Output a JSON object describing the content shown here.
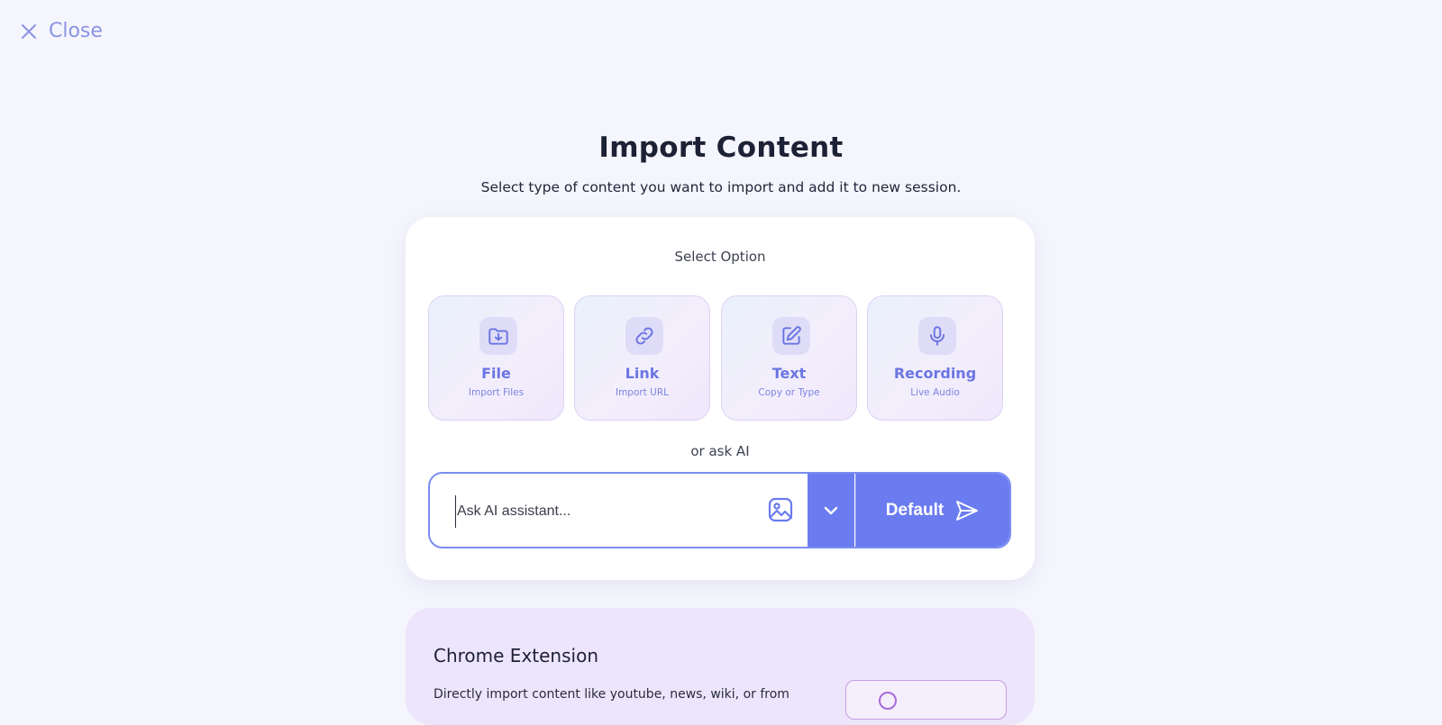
{
  "close": {
    "label": "Close",
    "icon": "close-icon"
  },
  "header": {
    "title": "Import Content",
    "subtitle": "Select type of content you want to import and add it to new session."
  },
  "select": {
    "label": "Select Option",
    "options": [
      {
        "name": "File",
        "sub": "Import Files",
        "icon": "folder-download-icon"
      },
      {
        "name": "Link",
        "sub": "Import URL",
        "icon": "link-icon"
      },
      {
        "name": "Text",
        "sub": "Copy or Type",
        "icon": "edit-icon"
      },
      {
        "name": "Recording",
        "sub": "Live Audio",
        "icon": "microphone-icon"
      }
    ]
  },
  "ai": {
    "or_label": "or ask AI",
    "placeholder": "Ask AI assistant...",
    "image_icon": "image-icon",
    "dropdown_icon": "chevron-down-icon",
    "send_label": "Default",
    "send_icon": "send-icon"
  },
  "extension": {
    "title": "Chrome Extension",
    "description": "Directly import content like youtube, news, wiki, or from"
  },
  "colors": {
    "accent": "#6b7cf1",
    "option_text": "#6b75e2",
    "close_text": "#8a94e3",
    "background": "#f5f5fd",
    "extension_card": "#ede5fc"
  }
}
